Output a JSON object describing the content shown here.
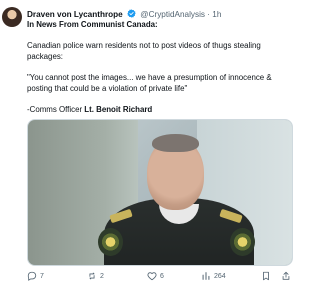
{
  "tweet": {
    "display_name": "Draven von Lycanthrope",
    "handle": "@CryptidAnalysis",
    "dot": "·",
    "time": "1h",
    "lines": [
      {
        "bold_prefix": "In News From Communist Canada:",
        "text": ""
      },
      {
        "bold_prefix": "",
        "text": "Canadian police warn residents not to post videos of thugs stealing packages:"
      },
      {
        "bold_prefix": "",
        "text": "\"You cannot post the images... we have a presumption of innocence & posting that could be a violation of private life\""
      },
      {
        "bold_prefix": "",
        "text": "-Comms Officer ",
        "bold_suffix": "Lt. Benoit Richard"
      }
    ],
    "actions": {
      "replies": "7",
      "reposts": "2",
      "likes": "6",
      "views": "264"
    },
    "colors": {
      "text": "#0f1419",
      "muted": "#536471",
      "verified": "#1d9bf0",
      "repost": "#536471"
    },
    "icons": {
      "verified": "verified-badge-icon",
      "reply": "reply-icon",
      "repost": "repost-icon",
      "like": "heart-icon",
      "views": "views-bar-chart-icon"
    }
  }
}
